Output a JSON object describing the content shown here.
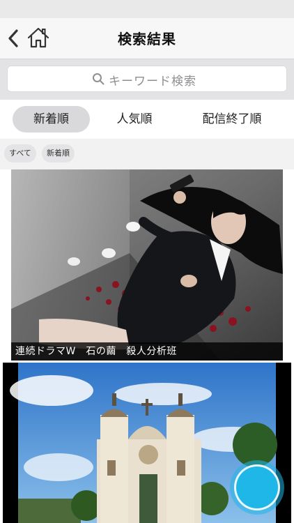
{
  "header": {
    "title": "検索結果"
  },
  "search": {
    "placeholder": "キーワード検索"
  },
  "sort_tabs": [
    {
      "label": "新着順",
      "active": true
    },
    {
      "label": "人気順",
      "active": false
    },
    {
      "label": "配信終了順",
      "active": false
    }
  ],
  "filter_chips": [
    "すべて",
    "新着順"
  ],
  "results": [
    {
      "caption": "連続ドラマW　石の繭　殺人分析班"
    }
  ],
  "colors": {
    "accent": "#1fb7e8",
    "tab_active": "#d9d9dc",
    "caption_bg": "#000000"
  },
  "icons": [
    "chevron-left-icon",
    "home-icon",
    "search-icon"
  ]
}
